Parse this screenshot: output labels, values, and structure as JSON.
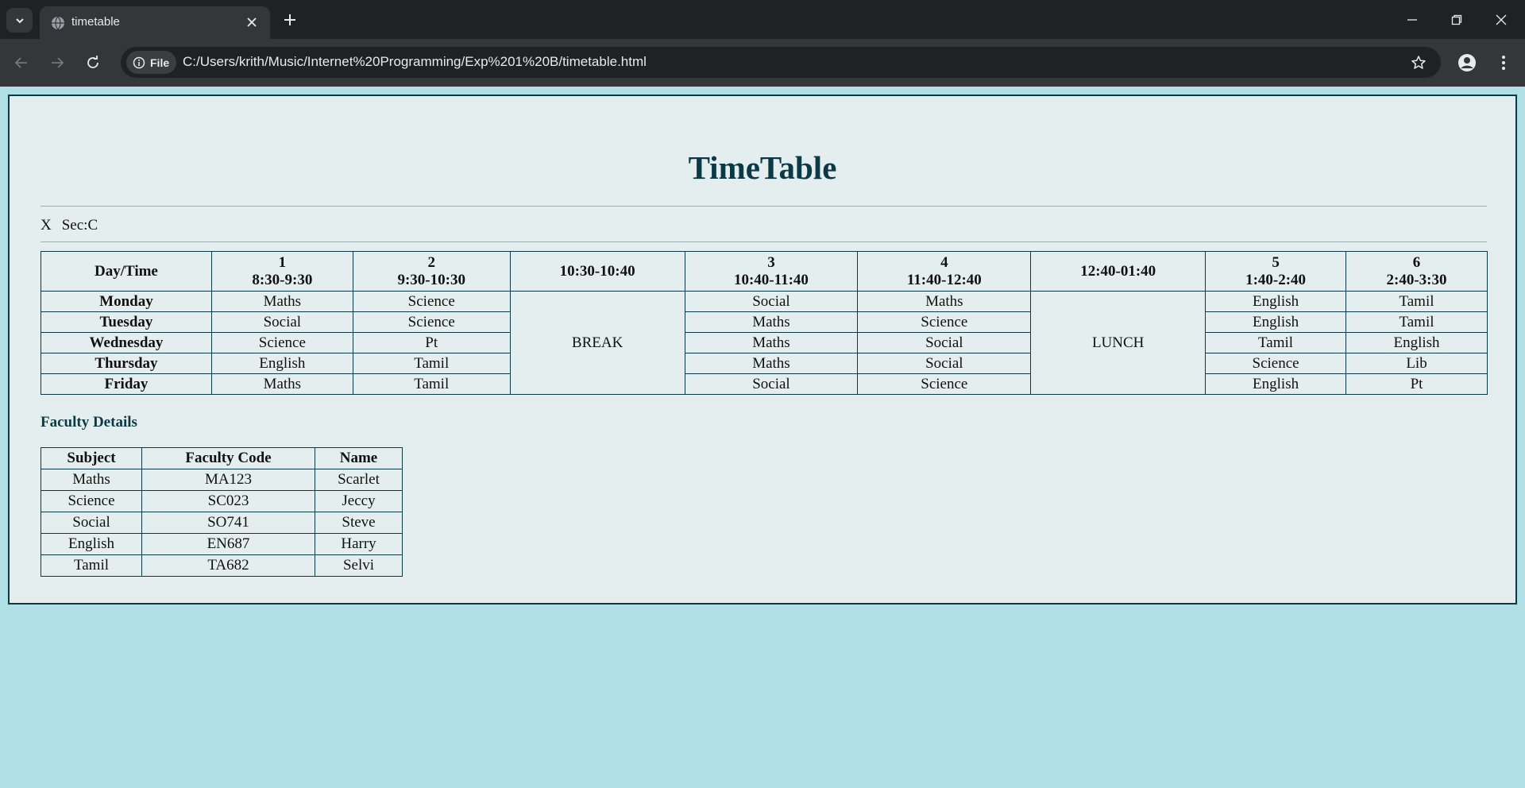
{
  "browser": {
    "tab_title": "timetable",
    "file_chip_label": "File",
    "url": "C:/Users/krith/Music/Internet%20Programming/Exp%201%20B/timetable.html"
  },
  "page": {
    "title": "TimeTable",
    "class_label": "X",
    "section_label": "Sec:C"
  },
  "timetable": {
    "header": {
      "day_time": "Day/Time",
      "p1_num": "1",
      "p1_time": "8:30-9:30",
      "p2_num": "2",
      "p2_time": "9:30-10:30",
      "break_time": "10:30-10:40",
      "p3_num": "3",
      "p3_time": "10:40-11:40",
      "p4_num": "4",
      "p4_time": "11:40-12:40",
      "lunch_time": "12:40-01:40",
      "p5_num": "5",
      "p5_time": "1:40-2:40",
      "p6_num": "6",
      "p6_time": "2:40-3:30"
    },
    "break_label": "BREAK",
    "lunch_label": "LUNCH",
    "rows": [
      {
        "day": "Monday",
        "p1": "Maths",
        "p2": "Science",
        "p3": "Social",
        "p4": "Maths",
        "p5": "English",
        "p6": "Tamil"
      },
      {
        "day": "Tuesday",
        "p1": "Social",
        "p2": "Science",
        "p3": "Maths",
        "p4": "Science",
        "p5": "English",
        "p6": "Tamil"
      },
      {
        "day": "Wednesday",
        "p1": "Science",
        "p2": "Pt",
        "p3": "Maths",
        "p4": "Social",
        "p5": "Tamil",
        "p6": "English"
      },
      {
        "day": "Thursday",
        "p1": "English",
        "p2": "Tamil",
        "p3": "Maths",
        "p4": "Social",
        "p5": "Science",
        "p6": "Lib"
      },
      {
        "day": "Friday",
        "p1": "Maths",
        "p2": "Tamil",
        "p3": "Social",
        "p4": "Science",
        "p5": "English",
        "p6": "Pt"
      }
    ]
  },
  "faculty": {
    "heading": "Faculty Details",
    "columns": [
      "Subject",
      "Faculty Code",
      "Name"
    ],
    "rows": [
      {
        "subject": "Maths",
        "code": "MA123",
        "name": "Scarlet"
      },
      {
        "subject": "Science",
        "code": "SC023",
        "name": "Jeccy"
      },
      {
        "subject": "Social",
        "code": "SO741",
        "name": "Steve"
      },
      {
        "subject": "English",
        "code": "EN687",
        "name": "Harry"
      },
      {
        "subject": "Tamil",
        "code": "TA682",
        "name": "Selvi"
      }
    ]
  },
  "colors": {
    "page_bg": "#b0dfe5",
    "panel_bg": "#e5eeee",
    "accent": "#0b3a46"
  }
}
